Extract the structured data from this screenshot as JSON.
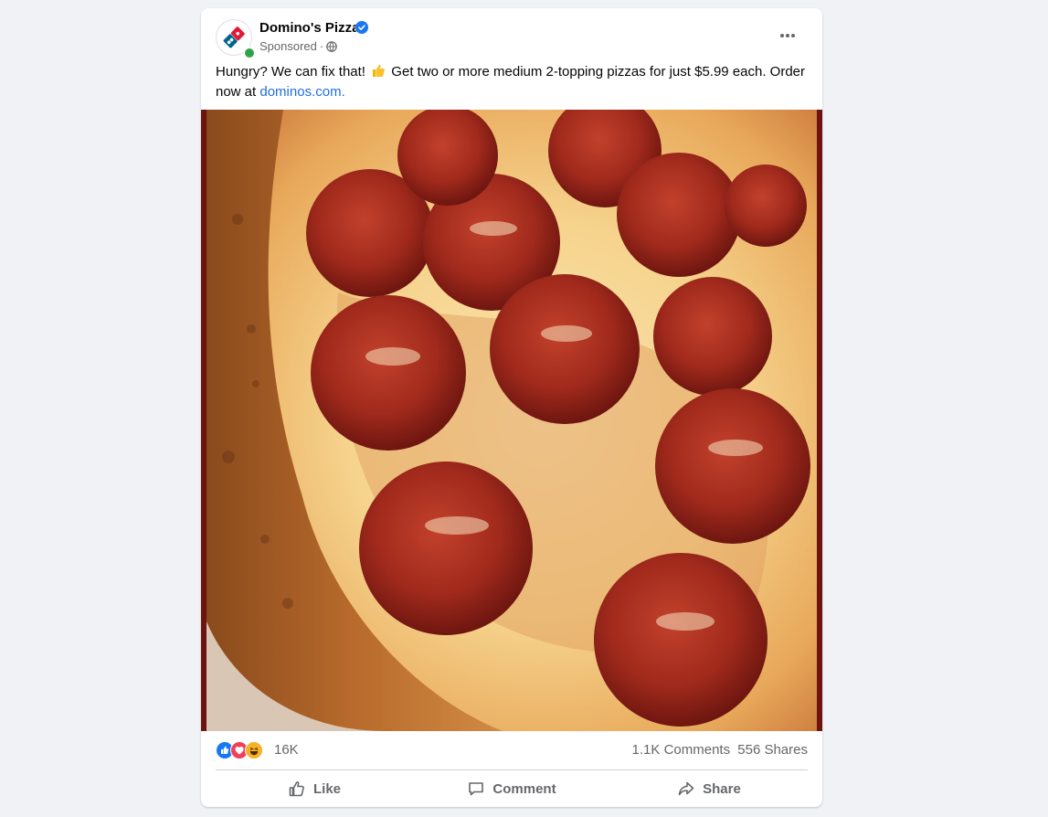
{
  "post": {
    "page_name": "Domino's Pizza",
    "sponsored_label": "Sponsored",
    "separator": "·",
    "caption_part1": "Hungry? We can fix that! ",
    "caption_emoji": "thumbs-up-emoji",
    "caption_part2": " Get two or more medium 2-topping pizzas for just $5.99 each. Order now at ",
    "caption_link": "dominos.com."
  },
  "icons": {
    "avatar_logo": "dominos-logo",
    "verified": "verified-badge-icon",
    "privacy": "globe-icon",
    "more": "more-options-icon",
    "reactions": [
      "like-reaction-icon",
      "love-reaction-icon",
      "haha-reaction-icon"
    ]
  },
  "engagement": {
    "reaction_count": "16K",
    "comments": "1.1K Comments",
    "shares": "556 Shares"
  },
  "actions": {
    "like": "Like",
    "comment": "Comment",
    "share": "Share"
  },
  "colors": {
    "brand_blue": "#006491",
    "brand_red": "#e31837",
    "link": "#216fdb",
    "muted_text": "#65676b",
    "verified": "#1877f2"
  }
}
